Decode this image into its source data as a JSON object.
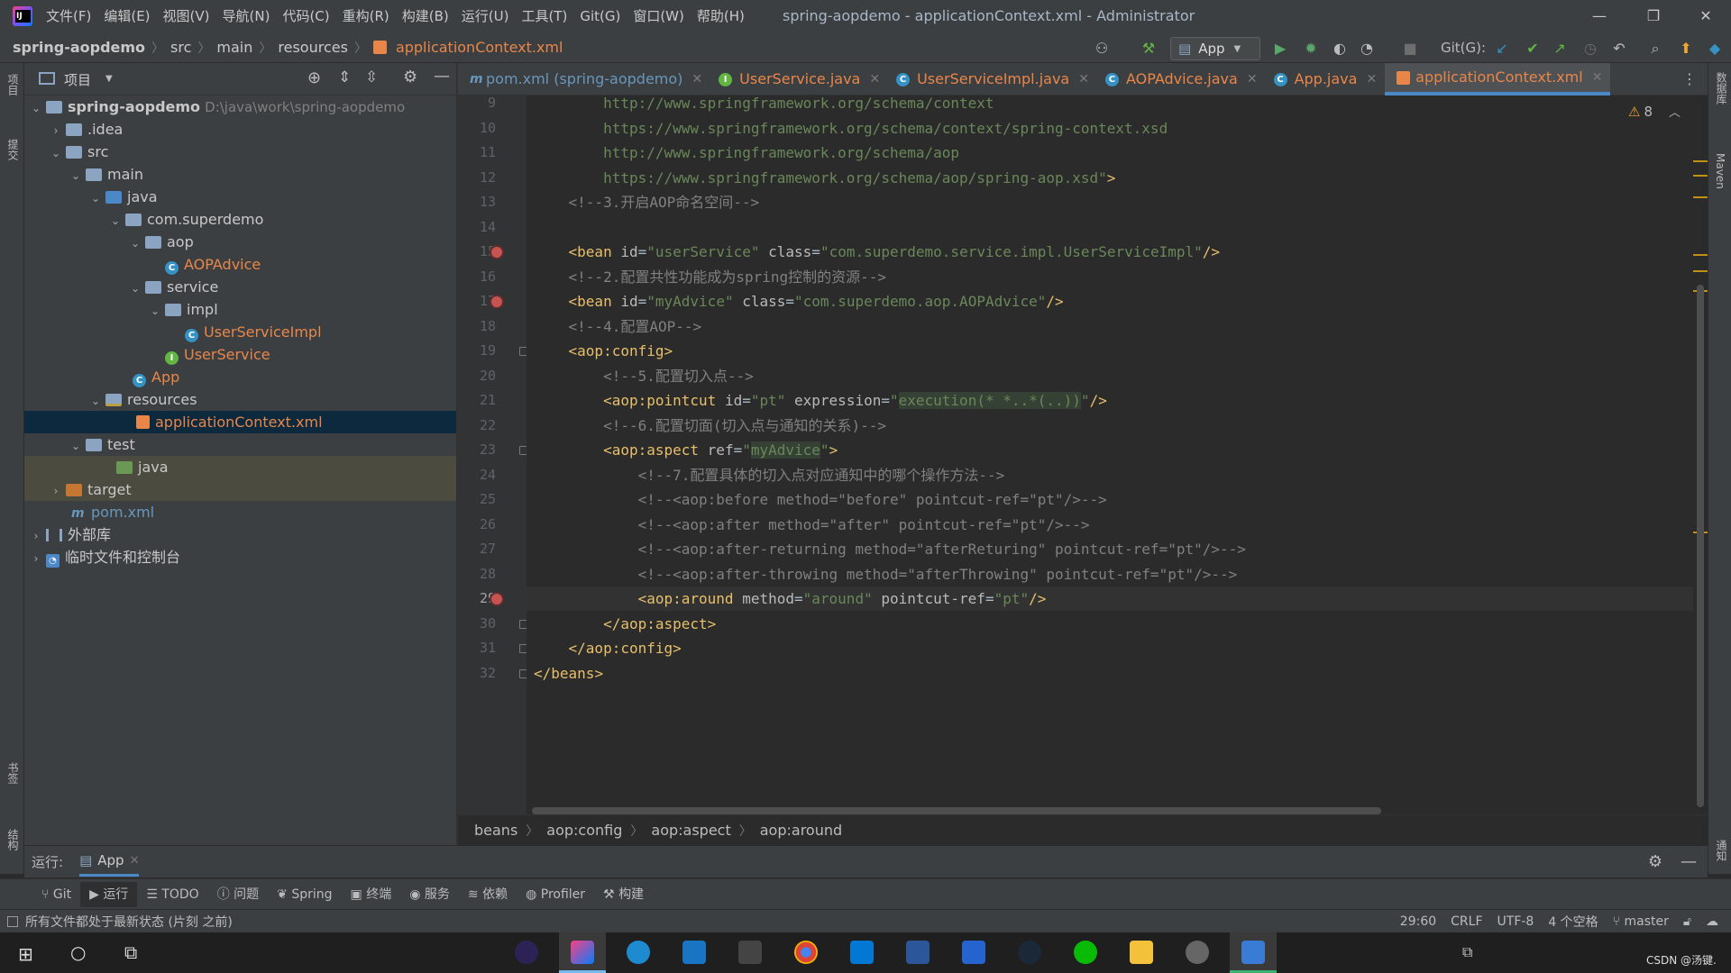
{
  "menu": [
    "文件(F)",
    "编辑(E)",
    "视图(V)",
    "导航(N)",
    "代码(C)",
    "重构(R)",
    "构建(B)",
    "运行(U)",
    "工具(T)",
    "Git(G)",
    "窗口(W)",
    "帮助(H)"
  ],
  "window_title": "spring-aopdemo - applicationContext.xml - Administrator",
  "window_controls": {
    "minimize": "—",
    "restore": "❐",
    "close": "✕"
  },
  "breadcrumb": [
    "spring-aopdemo",
    "src",
    "main",
    "resources",
    "applicationContext.xml"
  ],
  "run_config": "App",
  "git_label": "Git(G):",
  "project_panel": {
    "title": "项目"
  },
  "left_strip": {
    "project": "项目",
    "commit": "提交",
    "bookmarks": "书签",
    "structure": "结构"
  },
  "right_strip": {
    "database": "数据库",
    "maven": "Maven",
    "notifications": "通知"
  },
  "tree": [
    {
      "label": "spring-aopdemo",
      "hint": "D:\\java\\work\\spring-aopdemo"
    },
    {
      "label": ".idea"
    },
    {
      "label": "src"
    },
    {
      "label": "main"
    },
    {
      "label": "java"
    },
    {
      "label": "com.superdemo"
    },
    {
      "label": "aop"
    },
    {
      "label": "AOPAdvice"
    },
    {
      "label": "service"
    },
    {
      "label": "impl"
    },
    {
      "label": "UserServiceImpl"
    },
    {
      "label": "UserService"
    },
    {
      "label": "App"
    },
    {
      "label": "resources"
    },
    {
      "label": "applicationContext.xml"
    },
    {
      "label": "test"
    },
    {
      "label": "java"
    },
    {
      "label": "target"
    },
    {
      "label": "pom.xml"
    },
    {
      "label": "外部库"
    },
    {
      "label": "临时文件和控制台"
    }
  ],
  "tabs": [
    {
      "label": "pom.xml (spring-aopdemo)",
      "icon": "maven-icon",
      "color": "#6897bb"
    },
    {
      "label": "UserService.java",
      "icon": "interface-icon",
      "color": "#62b543"
    },
    {
      "label": "UserServiceImpl.java",
      "icon": "class-icon",
      "color": "#3592c4"
    },
    {
      "label": "AOPAdvice.java",
      "icon": "class-icon",
      "color": "#3592c4"
    },
    {
      "label": "App.java",
      "icon": "class-icon",
      "color": "#3592c4"
    },
    {
      "label": "applicationContext.xml",
      "icon": "xml-icon",
      "color": "#e8864a",
      "active": true
    }
  ],
  "warnings_count": "8",
  "line_numbers": [
    "9",
    "10",
    "11",
    "12",
    "13",
    "14",
    "15",
    "16",
    "17",
    "18",
    "19",
    "20",
    "21",
    "22",
    "23",
    "24",
    "25",
    "26",
    "27",
    "28",
    "29",
    "30",
    "31",
    "32"
  ],
  "code_lines": [
    "        http://www.springframework.org/schema/context",
    "        https://www.springframework.org/schema/context/spring-context.xsd",
    "        http://www.springframework.org/schema/aop",
    "        https://www.springframework.org/schema/aop/spring-aop.xsd\">",
    "    <!--3.开启AOP命名空间-->",
    "",
    "    <bean id=\"userService\" class=\"com.superdemo.service.impl.UserServiceImpl\"/>",
    "    <!--2.配置共性功能成为spring控制的资源-->",
    "    <bean id=\"myAdvice\" class=\"com.superdemo.aop.AOPAdvice\"/>",
    "    <!--4.配置AOP-->",
    "    <aop:config>",
    "        <!--5.配置切入点-->",
    "        <aop:pointcut id=\"pt\" expression=\"execution(* *..*(..))\"/>",
    "        <!--6.配置切面(切入点与通知的关系)-->",
    "        <aop:aspect ref=\"myAdvice\">",
    "            <!--7.配置具体的切入点对应通知中的哪个操作方法-->",
    "            <!--<aop:before method=\"before\" pointcut-ref=\"pt\"/>-->",
    "            <!--<aop:after method=\"after\" pointcut-ref=\"pt\"/>-->",
    "            <!--<aop:after-returning method=\"afterReturing\" pointcut-ref=\"pt\"/>-->",
    "            <!--<aop:after-throwing method=\"afterThrowing\" pointcut-ref=\"pt\"/>-->",
    "            <aop:around method=\"around\" pointcut-ref=\"pt\"/>",
    "        </aop:aspect>",
    "    </aop:config>",
    "</beans>"
  ],
  "editor_breadcrumb": [
    "beans",
    "aop:config",
    "aop:aspect",
    "aop:around"
  ],
  "run_panel": {
    "label": "运行:",
    "tab": "App"
  },
  "tool_windows": [
    "Git",
    "运行",
    "TODO",
    "问题",
    "Spring",
    "终端",
    "服务",
    "依赖",
    "Profiler",
    "构建"
  ],
  "status": {
    "message": "所有文件都处于最新状态 (片刻 之前)",
    "position": "29:60",
    "line_sep": "CRLF",
    "encoding": "UTF-8",
    "indent": "4 个空格",
    "branch": "master"
  },
  "taskbar": {
    "watermark": "CSDN @汤键."
  },
  "colors": {
    "accent": "#4a88c7",
    "tag": "#e8bf6a",
    "string": "#6a8759",
    "comment": "#808080"
  }
}
